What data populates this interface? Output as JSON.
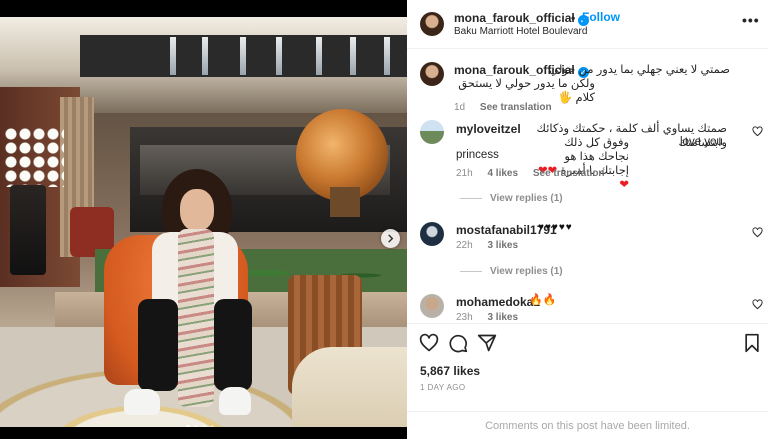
{
  "post": {
    "username": "mona_farouk_official",
    "verified_mark": "✓",
    "dot": "•",
    "follow_label": "Follow",
    "location": "Baku Marriott Hotel Boulevard",
    "more_icon": "•••",
    "caption_line1": "صمتي لا يعني جهلي بما يدور من حولي",
    "caption_line2": "ولكن ما يدور حولي لا يستحق كلام",
    "caption_emoji": "🖐️",
    "caption_time": "1d",
    "see_translation": "See translation"
  },
  "comments": [
    {
      "username": "myloveitzel",
      "text_line1": "صمتك يساوي ألف كلمة ، حكمتك وذكائك وابتسامتك",
      "text_line2": "وفوق كل ذلك نجاحك هذا هو إجابتك يا أميرة",
      "hearts_inline": "❤❤❤",
      "text_en1": "love you",
      "text_en2": "princess",
      "time": "21h",
      "likes": "4 likes",
      "see_translation": "See translation",
      "view_replies": "View replies (1)"
    },
    {
      "username": "mostafanabil1791",
      "text": "♥♥♥♥♥",
      "time": "22h",
      "likes": "3 likes",
      "view_replies": "View replies (1)"
    },
    {
      "username": "mohamedoka1",
      "text": "🔥🔥",
      "time": "23h",
      "likes": "3 likes"
    }
  ],
  "footer": {
    "likes": "5,867 likes",
    "ago": "1 DAY AGO",
    "limited_notice": "Comments on this post have been limited."
  },
  "icons": {
    "like": "heart-icon",
    "comment": "comment-icon",
    "share": "paper-plane-icon",
    "save": "bookmark-icon",
    "next": "chevron-right-icon"
  },
  "colors": {
    "accent": "#0095f6",
    "heart_red": "#ed1c24",
    "muted": "#8e8e8e"
  }
}
